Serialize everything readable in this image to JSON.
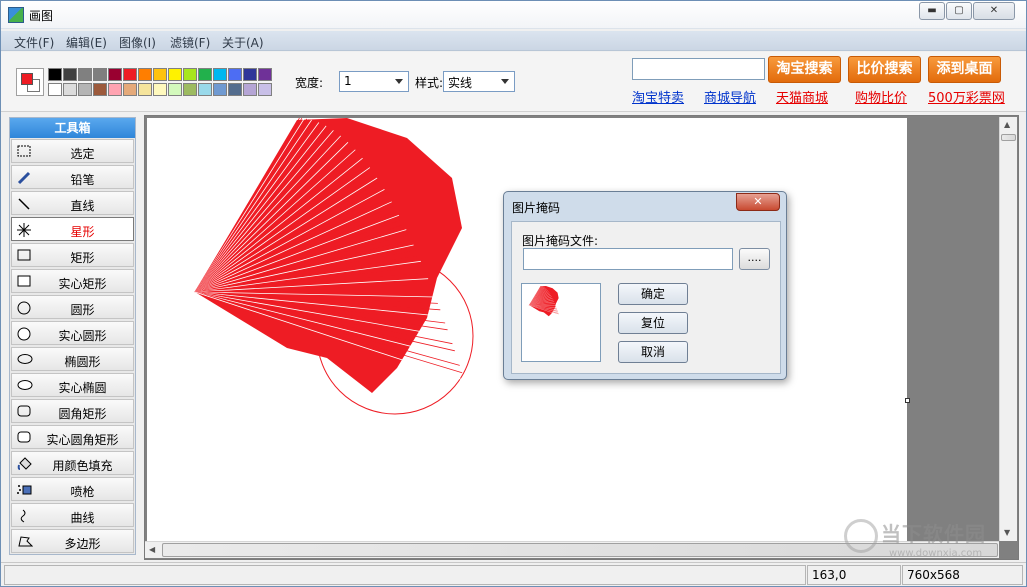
{
  "window": {
    "title": "画图"
  },
  "menu": [
    "文件(F)",
    "编辑(E)",
    "图像(I)",
    "滤镜(F)",
    "关于(A)"
  ],
  "toolbar": {
    "foreground_color": "#ee1c24",
    "background_color": "#ffffff",
    "palette_row1": [
      "#000000",
      "#404040",
      "#808080",
      "#7f7f7f",
      "#990030",
      "#ee1c24",
      "#ff7e00",
      "#ffc20e",
      "#fff200",
      "#a8e61d",
      "#22b14c",
      "#00b7ef",
      "#4d6df3",
      "#2f3699",
      "#6f3198"
    ],
    "palette_row2": [
      "#ffffff",
      "#dcdcdc",
      "#b4b4b4",
      "#9c5a3c",
      "#ffa3b1",
      "#e5aa7a",
      "#f5e49c",
      "#fff9bd",
      "#d3f9bc",
      "#9dbb61",
      "#99d9ea",
      "#709ad1",
      "#546d8e",
      "#b5a5d5",
      "#c8bfe7"
    ],
    "width_label": "宽度:",
    "width_value": "1",
    "style_label": "样式:",
    "style_value": "实线",
    "search_value": "",
    "buttons": [
      "淘宝搜索",
      "比价搜索",
      "添到桌面"
    ],
    "links": [
      {
        "text": "淘宝特卖",
        "color": "blue"
      },
      {
        "text": "商城导航",
        "color": "blue"
      },
      {
        "text": "天猫商城",
        "color": "red"
      },
      {
        "text": "购物比价",
        "color": "red"
      },
      {
        "text": "500万彩票网",
        "color": "red"
      }
    ]
  },
  "toolbox": {
    "title": "工具箱",
    "tools": [
      {
        "label": "选定",
        "icon": "select-icon"
      },
      {
        "label": "铅笔",
        "icon": "pencil-icon"
      },
      {
        "label": "直线",
        "icon": "line-icon"
      },
      {
        "label": "星形",
        "icon": "star-icon",
        "active": true
      },
      {
        "label": "矩形",
        "icon": "rectangle-icon"
      },
      {
        "label": "实心矩形",
        "icon": "filled-rectangle-icon"
      },
      {
        "label": "圆形",
        "icon": "circle-icon"
      },
      {
        "label": "实心圆形",
        "icon": "filled-circle-icon"
      },
      {
        "label": "椭圆形",
        "icon": "ellipse-icon"
      },
      {
        "label": "实心椭圆",
        "icon": "filled-ellipse-icon"
      },
      {
        "label": "圆角矩形",
        "icon": "rounded-rectangle-icon"
      },
      {
        "label": "实心圆角矩形",
        "icon": "filled-rounded-rectangle-icon"
      },
      {
        "label": "用颜色填充",
        "icon": "fill-bucket-icon"
      },
      {
        "label": "喷枪",
        "icon": "airbrush-icon"
      },
      {
        "label": "曲线",
        "icon": "curve-icon"
      },
      {
        "label": "多边形",
        "icon": "polygon-icon"
      }
    ]
  },
  "dialog": {
    "title": "图片掩码",
    "close_label": "✕",
    "file_label": "图片掩码文件:",
    "file_value": "",
    "browse_label": "....",
    "ok_label": "确定",
    "reset_label": "复位",
    "cancel_label": "取消"
  },
  "status": {
    "coords": "163,0",
    "size": "760x568"
  },
  "watermark": {
    "text": "当下软件园",
    "url": "www.downxia.com"
  }
}
